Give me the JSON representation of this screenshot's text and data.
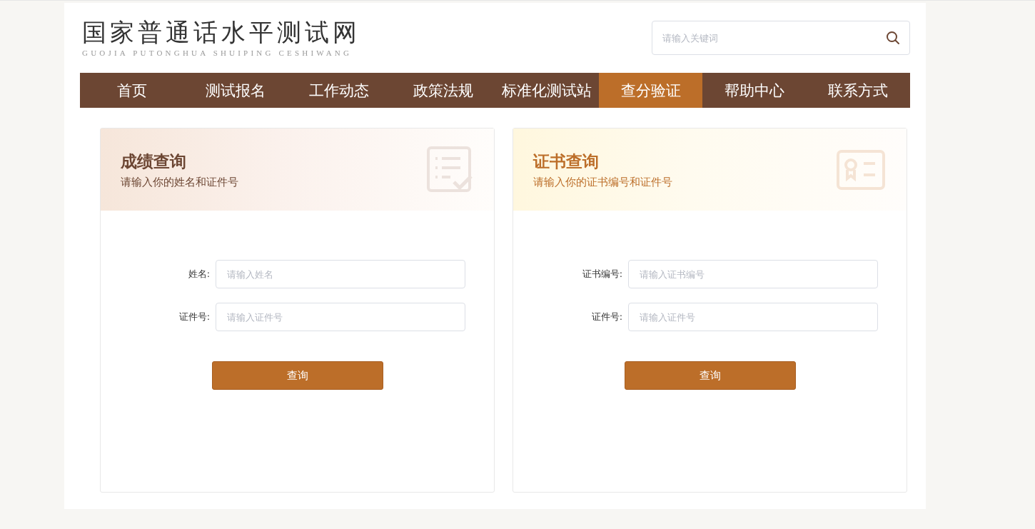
{
  "header": {
    "logo_title": "国家普通话水平测试网",
    "logo_subtitle": "GUOJIA PUTONGHUA SHUIPING CESHIWANG",
    "search": {
      "placeholder": "请输入关键词"
    }
  },
  "nav": [
    {
      "label": "首页",
      "selected": false
    },
    {
      "label": "测试报名",
      "selected": false
    },
    {
      "label": "工作动态",
      "selected": false
    },
    {
      "label": "政策法规",
      "selected": false
    },
    {
      "label": "标准化测试站",
      "selected": false
    },
    {
      "label": "查分验证",
      "selected": true
    },
    {
      "label": "帮助中心",
      "selected": false
    },
    {
      "label": "联系方式",
      "selected": false
    }
  ],
  "cards": [
    {
      "kind": "score",
      "title": "成绩查询",
      "subtitle": "请输入你的姓名和证件号",
      "fields": [
        {
          "label": "姓名:",
          "placeholder": "请输入姓名"
        },
        {
          "label": "证件号:",
          "placeholder": "请输入证件号"
        }
      ],
      "button": "查询"
    },
    {
      "kind": "certificate",
      "title": "证书查询",
      "subtitle": "请输入你的证书编号和证件号",
      "fields": [
        {
          "label": "证书编号:",
          "placeholder": "请输入证书编号"
        },
        {
          "label": "证件号:",
          "placeholder": "请输入证件号"
        }
      ],
      "button": "查询"
    }
  ]
}
